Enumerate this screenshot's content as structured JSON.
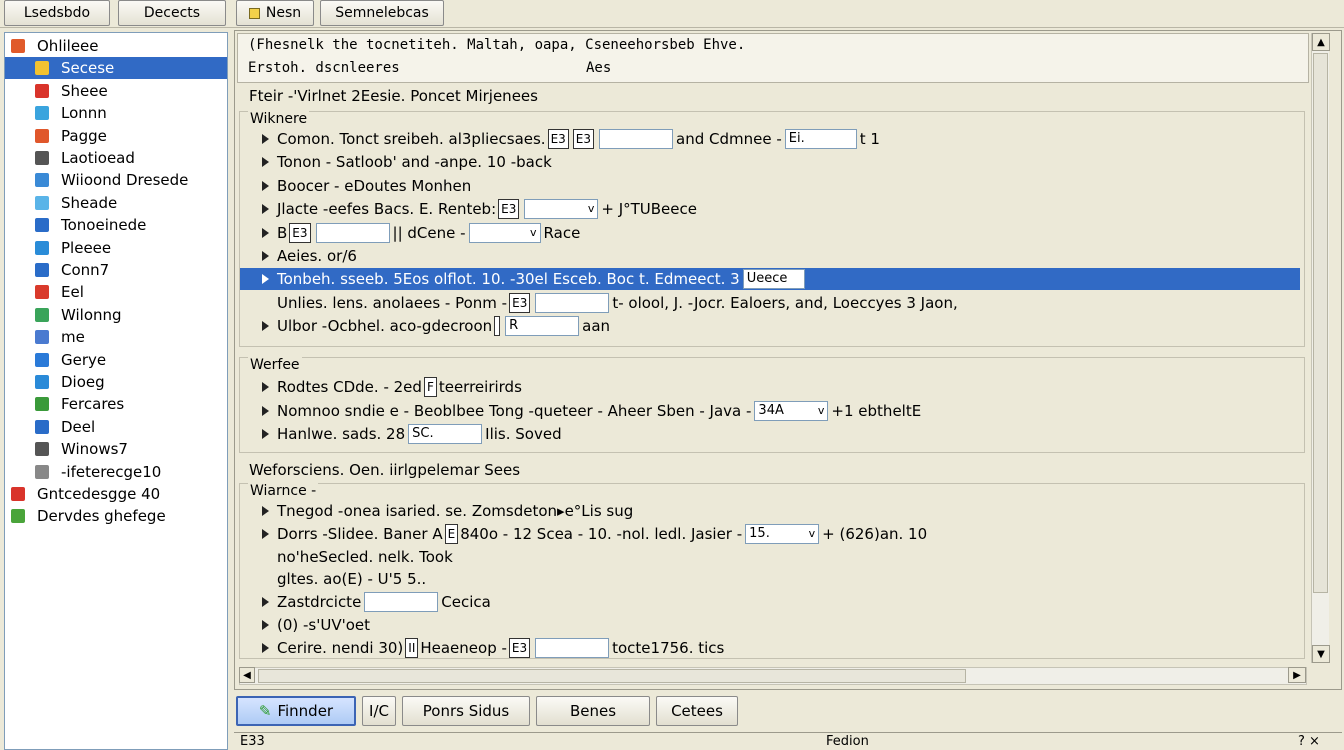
{
  "toolbar": {
    "left_buttons": [
      "Lsedsbdo",
      "Decects"
    ],
    "right_buttons": [
      "Nesn",
      "Semnelebcas"
    ]
  },
  "tree": [
    {
      "label": "Ohlileee",
      "icon": "windows-flag-icon",
      "color": "#e05a2a",
      "level": 0
    },
    {
      "label": "Secese",
      "icon": "folder-icon",
      "color": "#f2c230",
      "level": 1,
      "selected": true
    },
    {
      "label": "Sheee",
      "icon": "shield-icon",
      "color": "#d9342b",
      "level": 1
    },
    {
      "label": "Lonnn",
      "icon": "disk-icon",
      "color": "#3aa4de",
      "level": 1
    },
    {
      "label": "Pagge",
      "icon": "pages-icon",
      "color": "#e0572b",
      "level": 1
    },
    {
      "label": "Laotioead",
      "icon": "document-icon",
      "color": "#555555",
      "level": 1
    },
    {
      "label": "Wiioond Dresede",
      "icon": "window-icon",
      "color": "#3a8ad6",
      "level": 1
    },
    {
      "label": "Sheade",
      "icon": "network-icon",
      "color": "#5ab4e8",
      "level": 1
    },
    {
      "label": "Tonoeinede",
      "icon": "settings-icon",
      "color": "#2a6cc8",
      "level": 1
    },
    {
      "label": "Pleeee",
      "icon": "monitor-icon",
      "color": "#2a8cd8",
      "level": 1
    },
    {
      "label": "Conn7",
      "icon": "chart-icon",
      "color": "#2a6cc8",
      "level": 1
    },
    {
      "label": "Eel",
      "icon": "security-icon",
      "color": "#d93a2b",
      "level": 1
    },
    {
      "label": "Wilonng",
      "icon": "globe-icon",
      "color": "#3aa45a",
      "level": 1
    },
    {
      "label": "me",
      "icon": "user-icon",
      "color": "#4a7ad0",
      "level": 1
    },
    {
      "label": "Gerye",
      "icon": "gear-icon",
      "color": "#2a7ad8",
      "level": 1
    },
    {
      "label": "Dioeg",
      "icon": "dialog-icon",
      "color": "#2a8ad8",
      "level": 1
    },
    {
      "label": "Fercares",
      "icon": "features-icon",
      "color": "#3a9a3a",
      "level": 1
    },
    {
      "label": "Deel",
      "icon": "app-icon",
      "color": "#2a6cc8",
      "level": 1
    },
    {
      "label": "Winows7",
      "icon": "computer-icon",
      "color": "#555555",
      "level": 1
    },
    {
      "label": "-ifeterecge10",
      "icon": "dash-icon",
      "color": "#888888",
      "level": 1
    },
    {
      "label": "Gntcedesgge 40",
      "icon": "update-icon",
      "color": "#d9342b",
      "level": 0
    },
    {
      "label": "Dervdes ghefege",
      "icon": "devices-icon",
      "color": "#4aa43a",
      "level": 0
    }
  ],
  "header": {
    "line1": "(Fhesnelk the tocnetiteh. Maltah, oapa, Cseneehorsbeb Ehve.",
    "line2_left": "Erstoh. dscnleeres",
    "line2_right": "Aes"
  },
  "section1": {
    "title": "Fteir -'Virlnet 2Eesie. Poncet Mirjenees",
    "group": "Wiknere",
    "rows": [
      {
        "arrow": true,
        "pre": "Comon. Tonct sreibeh. al3pliecsaes.",
        "mini": "E3",
        "field": "",
        "post": "and Cdmnee -",
        "mini2": "E3",
        "field2": "Ei.",
        "post2": "t 1"
      },
      {
        "arrow": true,
        "pre": "Tonon - Satloob' and -anpe. 10 -back"
      },
      {
        "arrow": true,
        "pre": "Boocer - eDoutes Monhen"
      },
      {
        "arrow": true,
        "pre": "Jlacte -eefes Bacs. E. Renteb:",
        "mini": "E3",
        "field": "",
        "dd": "v",
        "post": "+ J°TUBeece"
      },
      {
        "arrow": true,
        "pre": "B",
        "field": "",
        "post": "|| dCene -",
        "mini2": "E3",
        "field2": "",
        "dd2": "v",
        "post2": "Race"
      },
      {
        "arrow": true,
        "pre": "Aeies. or/6"
      },
      {
        "arrow": true,
        "highlight": true,
        "pre": "Tonbeh. sseeb. 5Eos olflot. 10. -30el Esceb.   Boc t. Edmeect. 3",
        "field": "Ueece"
      },
      {
        "arrow": false,
        "pre": "Unlies. lens. anolaees - Ponm -",
        "mini": "E3",
        "field": "",
        "post": "t- olool, J. -Jocr. Ealoers, and, Loeccyes 3 Jaon,"
      },
      {
        "arrow": true,
        "pre": "Ulbor -Ocbhel. aco-gdecroon",
        "mini": "",
        "field": "R",
        "post": "aan"
      }
    ]
  },
  "section2": {
    "group": "Werfee",
    "rows": [
      {
        "arrow": true,
        "pre": "Rodtes CDde. - 2ed",
        "mini": "F",
        "post": "teerreirirds"
      },
      {
        "arrow": true,
        "pre": "Nomnoo sndie e - Beoblbee  Tong -queteer - Aheer Sben - Java -",
        "field": "34A",
        "dd": "v",
        "post": "+1 ebtheltE"
      },
      {
        "arrow": true,
        "pre": "Hanlwe. sads. 28",
        "field": "SC.",
        "post": "Ilis. Soved"
      }
    ]
  },
  "section3": {
    "title": "Weforsciens. Oen. iirlgpelemar Sees",
    "group": "Wiarnce -",
    "rows": [
      {
        "arrow": true,
        "pre": "Tnegod -onea isaried. se. Zomsdeton",
        "post": "e°Lis sug",
        "post_marker": "▸"
      },
      {
        "arrow": true,
        "pre": "Dorrs -Slidee. Baner A",
        "mini": "E",
        "pre2": "840o - 12 Scea - 10. -nol. ledl. Jasier -",
        "field": "15.",
        "dd": "v",
        "post": "+ (626)an. 10"
      },
      {
        "arrow": false,
        "pre": "no'heSecled. nelk. Took"
      },
      {
        "arrow": false,
        "pre": "gltes. ao(E) - U'5 5.."
      },
      {
        "arrow": true,
        "pre": "Zastdrcicte",
        "field": "",
        "post": "Cecica"
      },
      {
        "arrow": true,
        "pre": "(0) -s'UV'oet"
      },
      {
        "arrow": true,
        "pre": "Cerire. nendi 30)",
        "mini": "II",
        "pre2": "Heaeneop -",
        "mini2": "E3",
        "field": "",
        "post": "tocte1756. tics"
      }
    ]
  },
  "bottom_buttons": {
    "primary": "Finnder",
    "small": "I/C",
    "b1": "Ponrs Sidus",
    "b2": "Benes",
    "b3": "Cetees"
  },
  "status": {
    "left": "E33",
    "center": "Fedion",
    "right": "? ×"
  }
}
